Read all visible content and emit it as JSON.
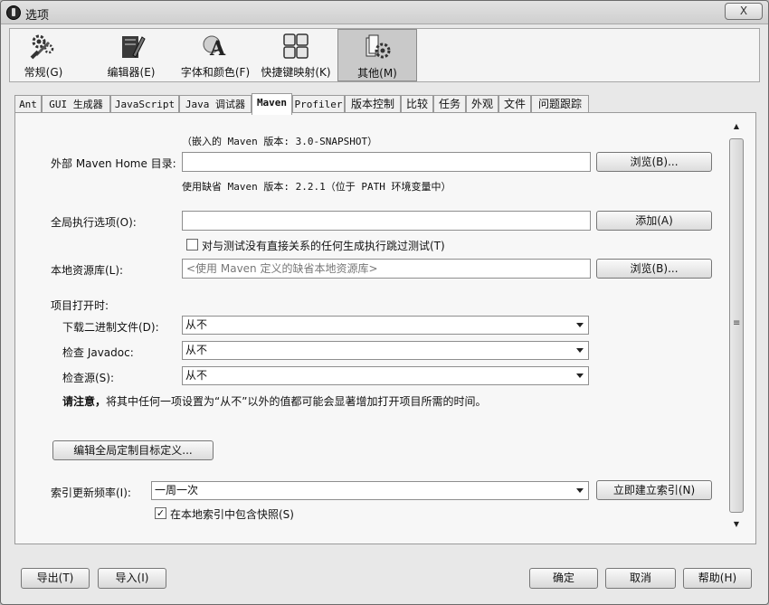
{
  "window": {
    "title": "选项",
    "close_label": "X"
  },
  "toolbar": {
    "items": [
      {
        "label": "常规(G)",
        "icon": "gear-wrench-icon"
      },
      {
        "label": "编辑器(E)",
        "icon": "editor-pen-icon"
      },
      {
        "label": "字体和颜色(F)",
        "icon": "font-color-icon"
      },
      {
        "label": "快捷键映射(K)",
        "icon": "keyboard-icon"
      },
      {
        "label": "其他(M)",
        "icon": "misc-gear-icon"
      }
    ]
  },
  "tabs": [
    "Ant",
    "GUI 生成器",
    "JavaScript",
    "Java 调试器",
    "Maven",
    "Profiler",
    "版本控制",
    "比较",
    "任务",
    "外观",
    "文件",
    "问题跟踪"
  ],
  "maven": {
    "embedded_version": "（嵌入的 Maven 版本: 3.0-SNAPSHOT）",
    "home_label": "外部 Maven Home 目录:",
    "home_value": "",
    "browse1": "浏览(B)...",
    "default_version": "使用缺省 Maven 版本: 2.2.1（位于 PATH 环境变量中）",
    "global_opts_label": "全局执行选项(O):",
    "global_opts_value": "",
    "add_label": "添加(A)",
    "skip_tests_label": "对与测试没有直接关系的任何生成执行跳过测试(T)",
    "skip_tests_checked": false,
    "local_repo_label": "本地资源库(L):",
    "local_repo_placeholder": "<使用 Maven 定义的缺省本地资源库>",
    "browse2": "浏览(B)...",
    "on_open_label": "项目打开时:",
    "download_binaries_label": "下载二进制文件(D):",
    "download_binaries_value": "从不",
    "check_javadoc_label": "检查 Javadoc:",
    "check_javadoc_value": "从不",
    "check_sources_label": "检查源(S):",
    "check_sources_value": "从不",
    "note_bold": "请注意，",
    "note_text": "将其中任何一项设置为“从不”以外的值都可能会显著增加打开项目所需的时间。",
    "edit_goals_label": "编辑全局定制目标定义...",
    "index_freq_label": "索引更新频率(I):",
    "index_freq_value": "一周一次",
    "index_now_label": "立即建立索引(N)",
    "snapshots_label": "在本地索引中包含快照(S)",
    "snapshots_checked": true
  },
  "footer": {
    "export_label": "导出(T)",
    "import_label": "导入(I)",
    "ok_label": "确定",
    "cancel_label": "取消",
    "help_label": "帮助(H)"
  }
}
